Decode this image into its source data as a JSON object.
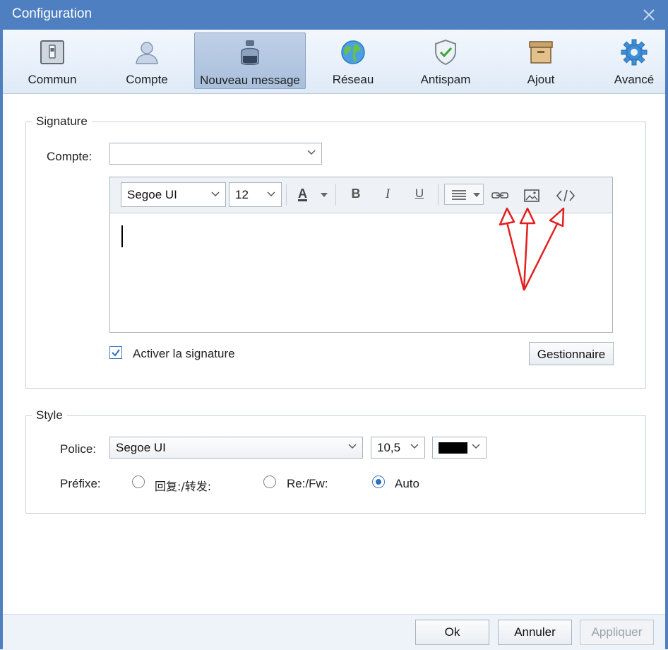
{
  "window": {
    "title": "Configuration"
  },
  "toolbar": {
    "items": [
      {
        "label": "Commun",
        "icon": "general-icon"
      },
      {
        "label": "Compte",
        "icon": "account-icon"
      },
      {
        "label": "Nouveau message",
        "icon": "inkwell-icon",
        "active": true
      },
      {
        "label": "Réseau",
        "icon": "globe-icon"
      },
      {
        "label": "Antispam",
        "icon": "shield-icon"
      },
      {
        "label": "Ajout",
        "icon": "archive-box-icon"
      },
      {
        "label": "Avancé",
        "icon": "gear-icon"
      }
    ]
  },
  "signature": {
    "legend": "Signature",
    "account_label": "Compte:",
    "account_value": "",
    "font_value": "Segoe UI",
    "size_value": "12",
    "bold_label": "B",
    "italic_label": "I",
    "underline_label": "U",
    "font_color_label": "A",
    "enable_label": "Activer la signature",
    "enable_checked": true,
    "manager_label": "Gestionnaire"
  },
  "style": {
    "legend": "Style",
    "font_label": "Police:",
    "font_value": "Segoe UI",
    "size_value": "10,5",
    "color_value": "#000000",
    "prefix_label": "Préfixe:",
    "prefix_options": [
      "回复:/转发:",
      "Re:/Fw:",
      "Auto"
    ],
    "prefix_selected": "Auto"
  },
  "footer": {
    "ok_label": "Ok",
    "cancel_label": "Annuler",
    "apply_label": "Appliquer"
  },
  "colors": {
    "titlebar": "#4e7fc0",
    "accent": "#3b78c4",
    "annotation": "#e51e1e"
  }
}
